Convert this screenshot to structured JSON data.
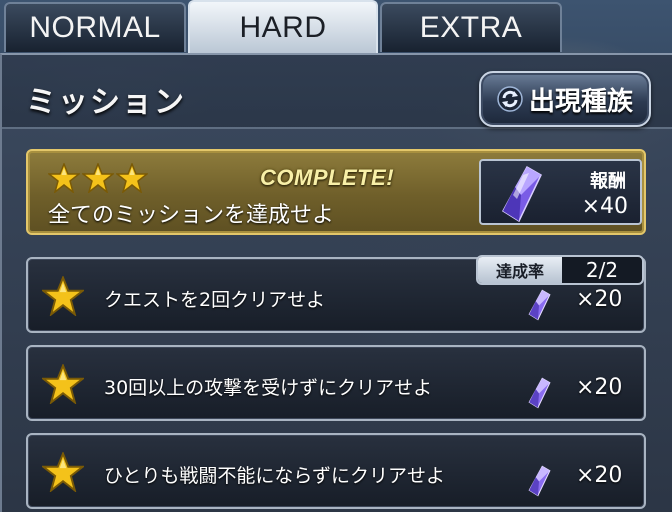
{
  "tabs": [
    {
      "label": "NORMAL",
      "active": false
    },
    {
      "label": "HARD",
      "active": true
    },
    {
      "label": "EXTRA",
      "active": false
    }
  ],
  "panel": {
    "title": "ミッション",
    "enemy_button": {
      "label": "出現種族",
      "icon": "refresh-icon"
    }
  },
  "complete_mission": {
    "stars": 3,
    "status": "COMPLETE!",
    "description": "全てのミッションを達成せよ",
    "reward_label": "報酬",
    "reward_qty": "×40",
    "reward_icon": "crystal-icon"
  },
  "missions": [
    {
      "description": "クエストを2回クリアせよ",
      "reward_qty": "×20",
      "progress_label": "達成率",
      "progress_value": "2/2"
    },
    {
      "description": "30回以上の攻撃を受けずにクリアせよ",
      "reward_qty": "×20"
    },
    {
      "description": "ひとりも戦闘不能にならずにクリアせよ",
      "reward_qty": "×20"
    }
  ],
  "colors": {
    "star_gold": "#f4c21a",
    "crystal_purple": "#8a6cf0",
    "complete_gold": "#f8f0a8"
  }
}
